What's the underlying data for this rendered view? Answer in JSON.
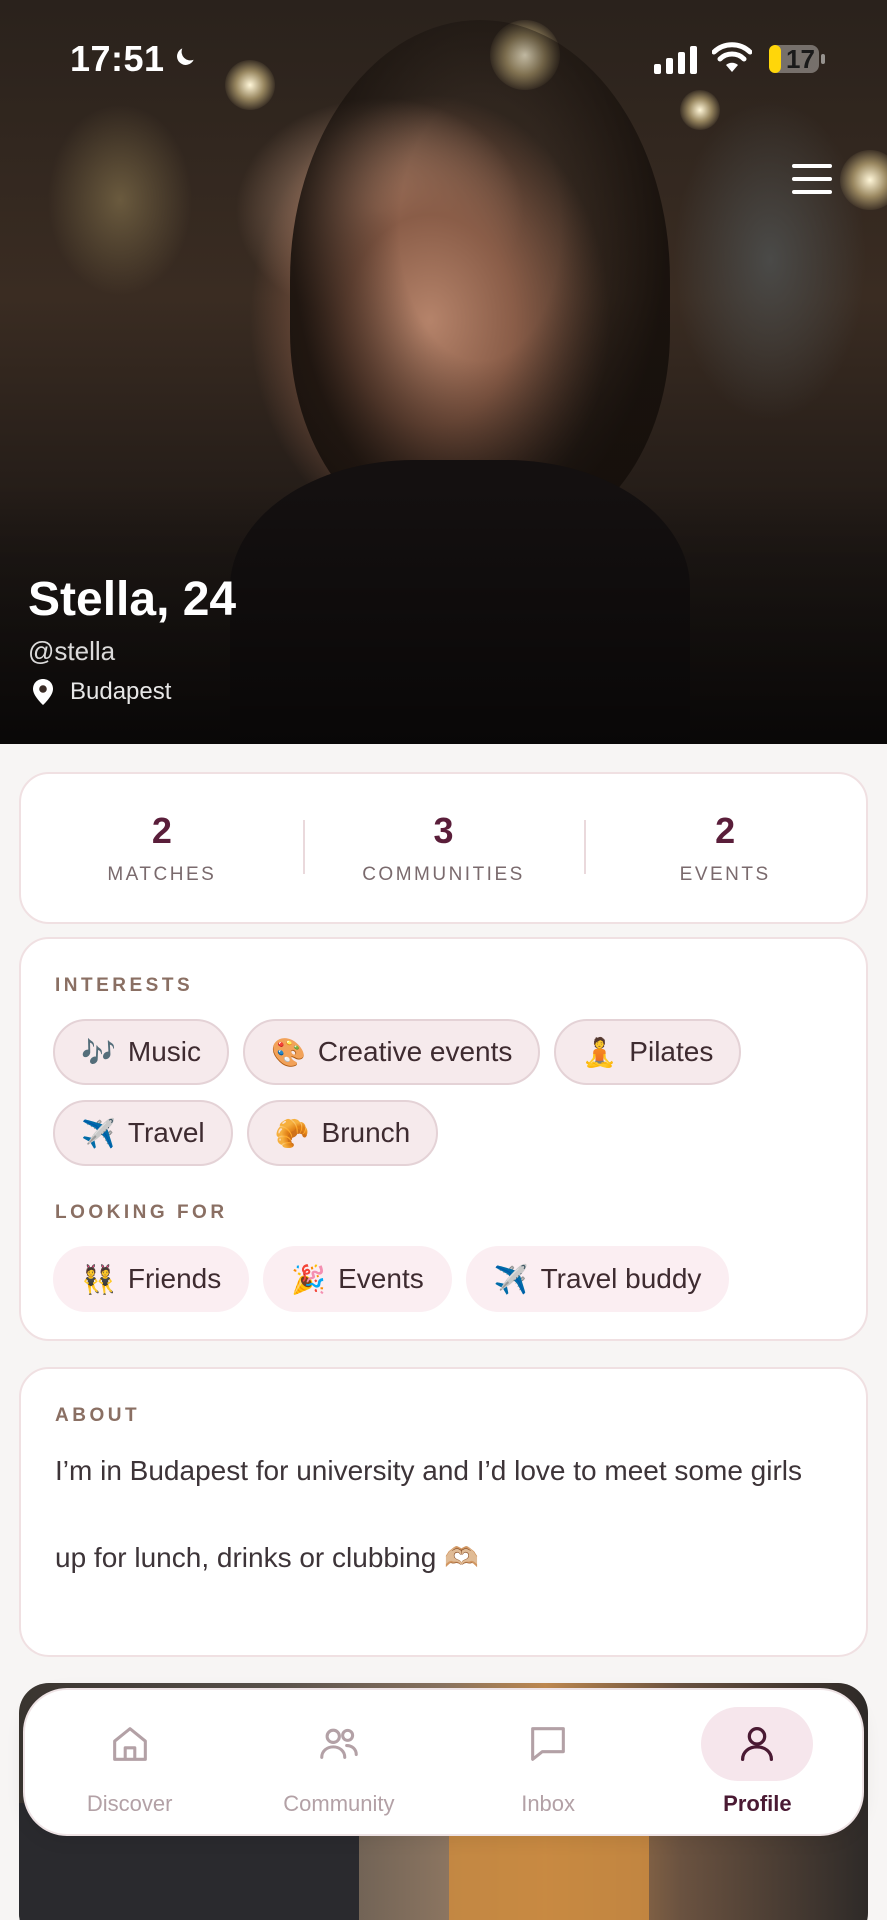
{
  "status_bar": {
    "time": "17:51",
    "battery": "17"
  },
  "profile": {
    "name_age": "Stella, 24",
    "handle": "@stella",
    "location": "Budapest"
  },
  "stats": [
    {
      "value": "2",
      "label": "MATCHES"
    },
    {
      "value": "3",
      "label": "COMMUNITIES"
    },
    {
      "value": "2",
      "label": "EVENTS"
    }
  ],
  "interests": {
    "label": "INTERESTS",
    "chips": [
      {
        "emoji": "🎶",
        "label": "Music"
      },
      {
        "emoji": "🎨",
        "label": "Creative events"
      },
      {
        "emoji": "🧘",
        "label": "Pilates"
      },
      {
        "emoji": "✈️",
        "label": "Travel"
      },
      {
        "emoji": "🥐",
        "label": "Brunch"
      }
    ]
  },
  "looking_for": {
    "label": "LOOKING FOR",
    "chips": [
      {
        "emoji": "👯",
        "label": "Friends"
      },
      {
        "emoji": "🎉",
        "label": "Events"
      },
      {
        "emoji": "✈️",
        "label": "Travel buddy"
      }
    ]
  },
  "about": {
    "label": "ABOUT",
    "paragraph_1": "I’m in Budapest for university and I’d love to meet some girls",
    "paragraph_2": "up for lunch, drinks or clubbing 🫶🏼"
  },
  "nav": [
    {
      "label": "Discover",
      "icon": "home-icon",
      "active": false
    },
    {
      "label": "Community",
      "icon": "people-icon",
      "active": false
    },
    {
      "label": "Inbox",
      "icon": "chat-icon",
      "active": false
    },
    {
      "label": "Profile",
      "icon": "person-icon",
      "active": true
    }
  ],
  "colors": {
    "accent": "#5a1e3a",
    "chip_bg": "#f6eaec",
    "page_bg": "#f7f5f4",
    "nav_active_bg": "#f6e6ec"
  }
}
